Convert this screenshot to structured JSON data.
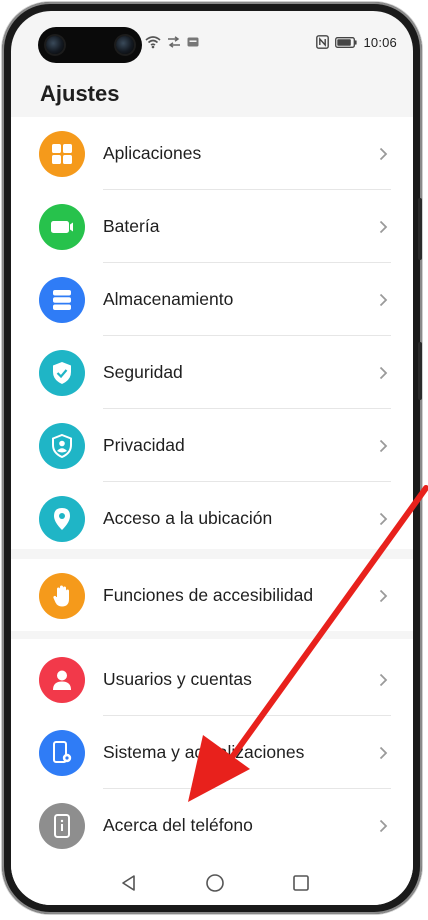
{
  "status_bar": {
    "time": "10:06",
    "notification_icons": [
      "wifi-icon",
      "data-saver-icon",
      "notification-icon"
    ],
    "right_icons": [
      "nfc-icon",
      "battery-icon"
    ]
  },
  "header": {
    "title": "Ajustes"
  },
  "settings": {
    "items": [
      {
        "label": "Aplicaciones",
        "icon": "apps-grid-icon",
        "color": "#F59A1B"
      },
      {
        "label": "Batería",
        "icon": "battery-icon",
        "color": "#27C24C"
      },
      {
        "label": "Almacenamiento",
        "icon": "storage-icon",
        "color": "#2F7CF6"
      },
      {
        "label": "Seguridad",
        "icon": "shield-check-icon",
        "color": "#1FB5C6"
      },
      {
        "label": "Privacidad",
        "icon": "privacy-shield-icon",
        "color": "#1FB5C6"
      },
      {
        "label": "Acceso a la ubicación",
        "icon": "location-pin-icon",
        "color": "#1FB5C6"
      },
      {
        "label": "Funciones de accesibilidad",
        "icon": "hand-icon",
        "color": "#F59A1B"
      },
      {
        "label": "Usuarios y cuentas",
        "icon": "user-icon",
        "color": "#F2394A"
      },
      {
        "label": "Sistema y actualizaciones",
        "icon": "system-update-icon",
        "color": "#2F7CF6"
      },
      {
        "label": "Acerca del teléfono",
        "icon": "phone-info-icon",
        "color": "#8E8E8E"
      }
    ]
  },
  "nav_bar": {
    "buttons": [
      "back-icon",
      "home-icon",
      "recents-icon"
    ]
  },
  "annotation": {
    "arrow_color": "#E8211C"
  }
}
